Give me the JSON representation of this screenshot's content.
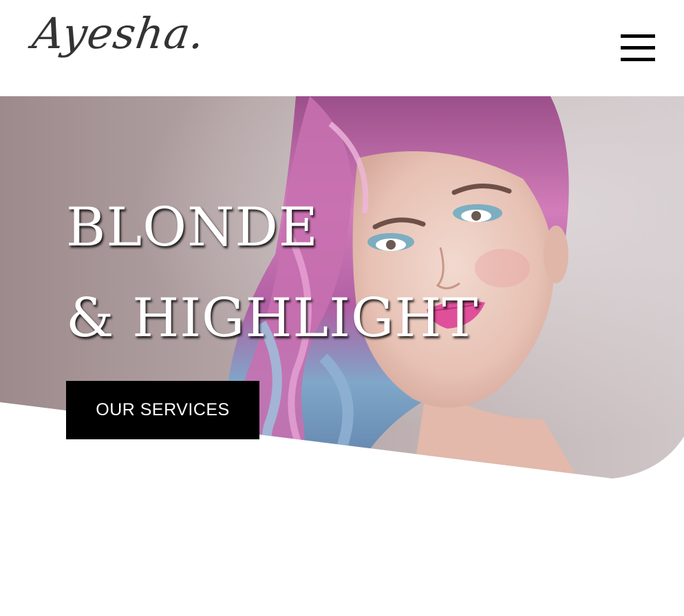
{
  "header": {
    "logo_text": "Ayesha.",
    "menu_icon": "hamburger-menu-icon"
  },
  "hero": {
    "headline_line1": "BLONDE",
    "headline_line2": "& HIGHLIGHT",
    "cta_label": "OUR SERVICES",
    "image": "woman-with-pastel-hair-photo"
  },
  "colors": {
    "text_primary": "#000000",
    "headline": "#ffffff",
    "cta_background": "#000000",
    "cta_text": "#ffffff",
    "hero_backdrop": "#a89a9a",
    "hair_pink": "#c86aa8",
    "hair_blue": "#7fa7c9"
  }
}
